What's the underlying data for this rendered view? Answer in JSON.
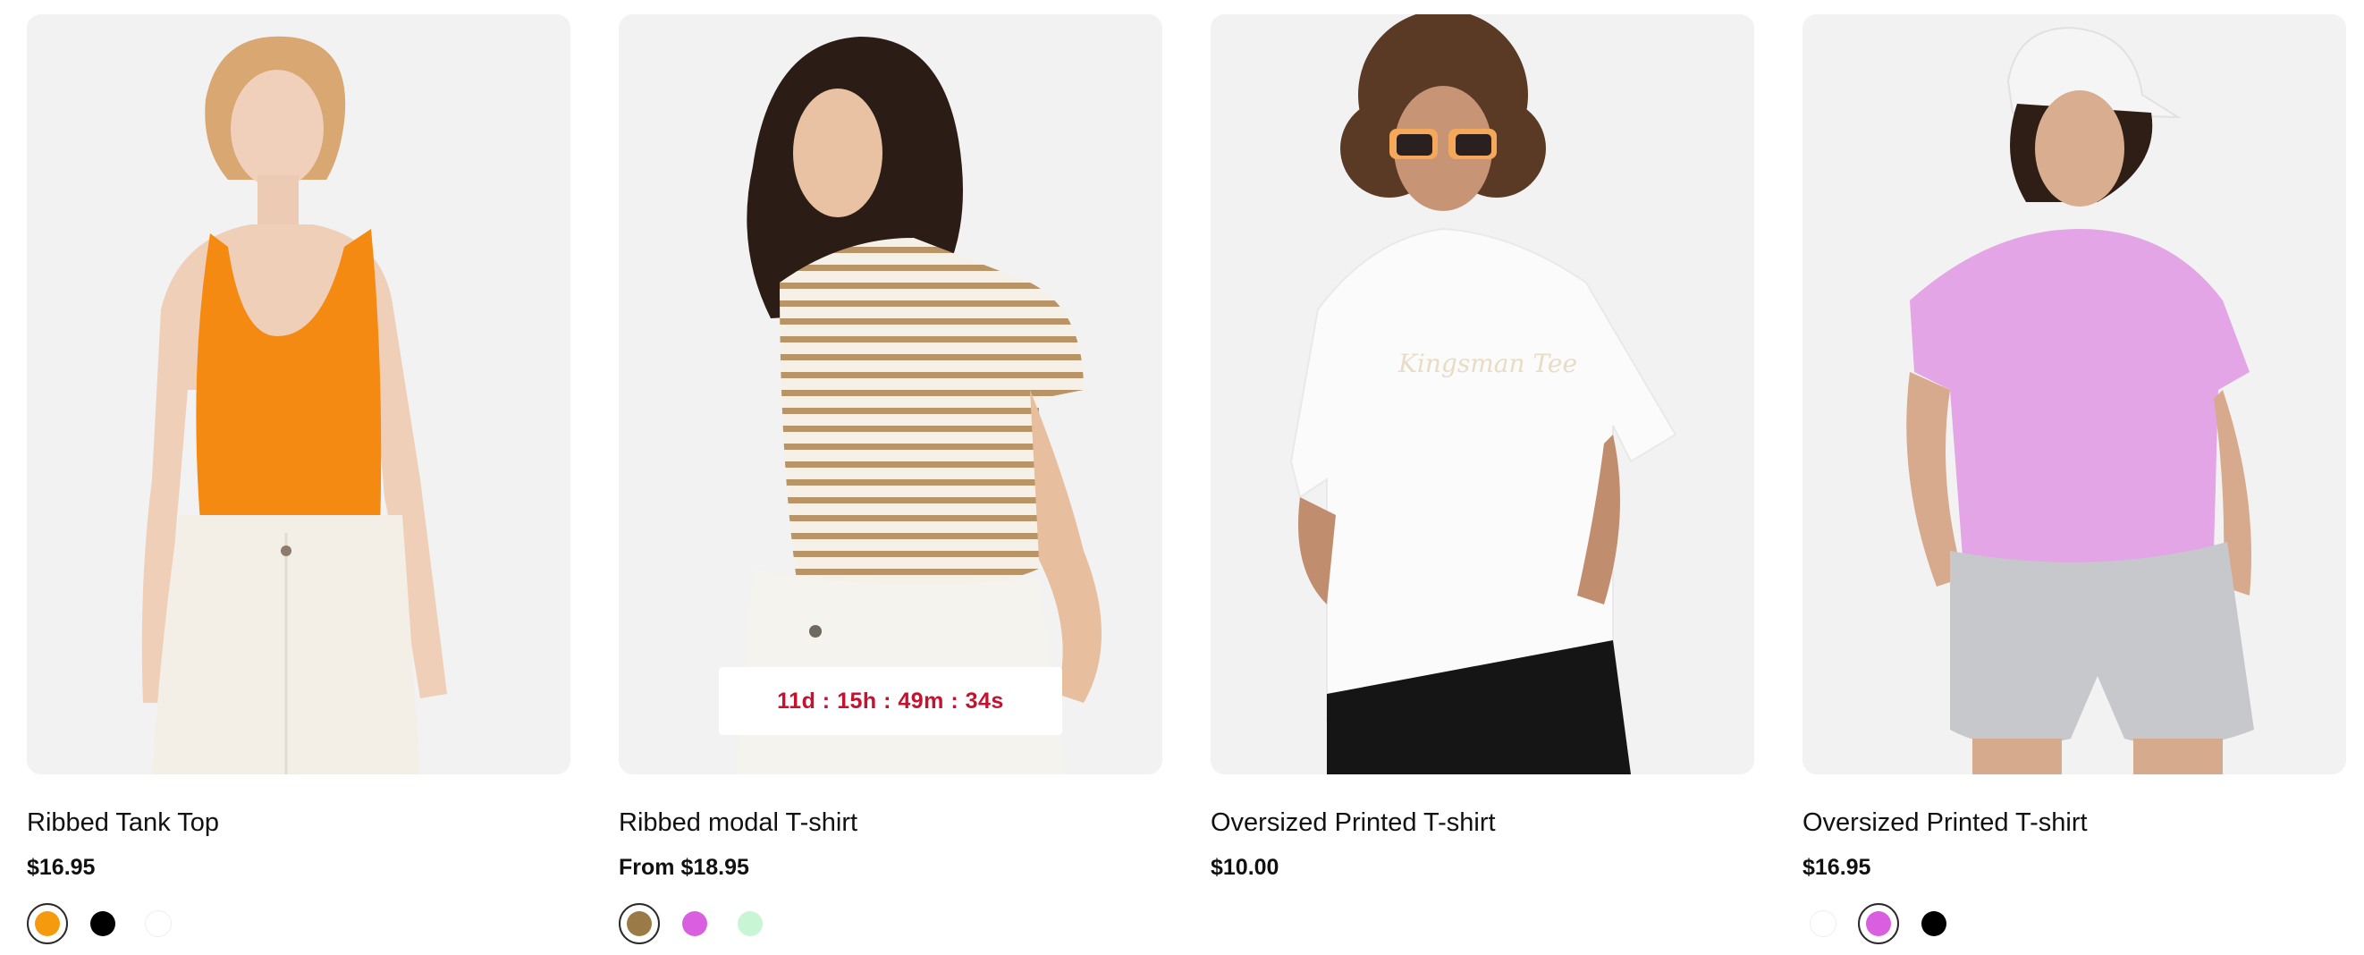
{
  "products": [
    {
      "name": "Ribbed Tank Top",
      "price": "$16.95",
      "swatches": [
        {
          "color": "#f59a0f",
          "selected": true
        },
        {
          "color": "#000000",
          "selected": false
        },
        {
          "color": "#ffffff",
          "selected": false
        }
      ]
    },
    {
      "name": "Ribbed modal T-shirt",
      "price": "From $18.95",
      "countdown": "11d : 15h : 49m : 34s",
      "swatches": [
        {
          "color": "#9a7a45",
          "selected": true
        },
        {
          "color": "#d95ee0",
          "selected": false
        },
        {
          "color": "#c8f5d4",
          "selected": false
        }
      ]
    },
    {
      "name": "Oversized Printed T-shirt",
      "price": "$10.00",
      "swatches": []
    },
    {
      "name": "Oversized Printed T-shirt",
      "price": "$16.95",
      "swatches": [
        {
          "color": "#ffffff",
          "selected": false
        },
        {
          "color": "#d95ee0",
          "selected": true
        },
        {
          "color": "#000000",
          "selected": false
        }
      ]
    }
  ],
  "colors": {
    "countdown_text": "#c4122f",
    "image_background": "#f2f2f2"
  }
}
